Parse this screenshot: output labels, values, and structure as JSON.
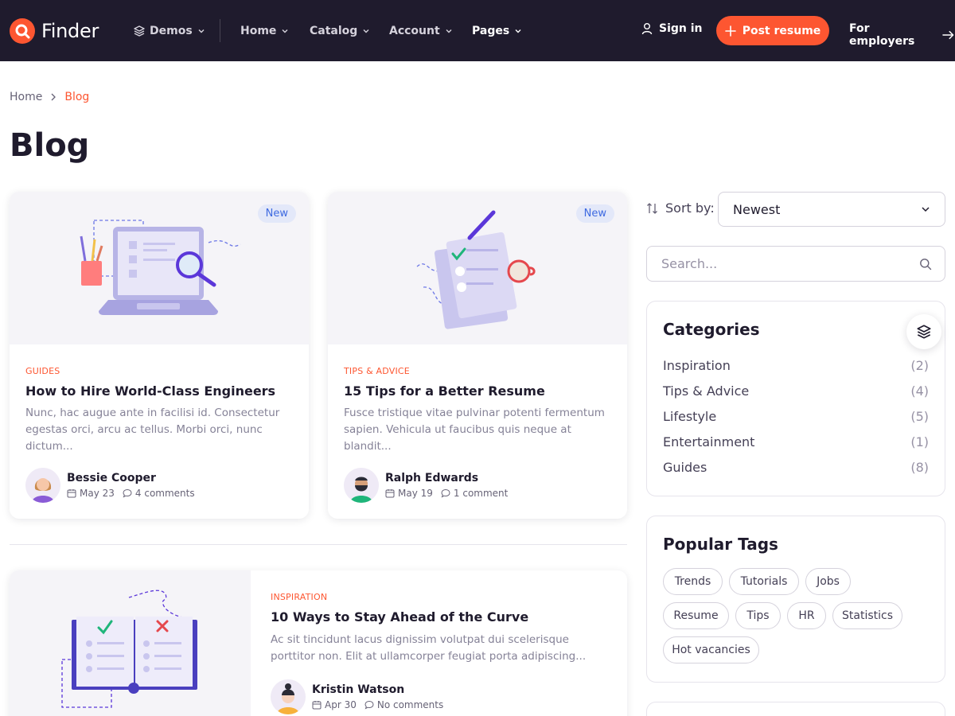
{
  "brand": {
    "name": "Finder",
    "accent": "#fd5631",
    "nav_bg": "#1f1b2d"
  },
  "nav": {
    "demos": "Demos",
    "home": "Home",
    "catalog": "Catalog",
    "account": "Account",
    "pages": "Pages",
    "sign_in": "Sign in",
    "post_resume": "Post resume",
    "for_employers": "For employers"
  },
  "breadcrumb": {
    "home": "Home",
    "current": "Blog"
  },
  "page_title": "Blog",
  "posts": [
    {
      "badge": "New",
      "category": "Guides",
      "title": "How to Hire World-Class Engineers",
      "excerpt": "Nunc, hac augue ante in facilisi id. Consectetur egestas orci, arcu ac tellus. Morbi orci, nunc dictum...",
      "author": "Bessie Cooper",
      "date": "May 23",
      "comments": "4 comments"
    },
    {
      "badge": "New",
      "category": "Tips & Advice",
      "title": "15 Tips for a Better Resume",
      "excerpt": "Fusce tristique vitae pulvinar potenti fermentum sapien. Vehicula ut faucibus quis neque at blandit...",
      "author": "Ralph Edwards",
      "date": "May 19",
      "comments": "1 comment"
    },
    {
      "category": "Inspiration",
      "title": "10 Ways to Stay Ahead of the Curve",
      "excerpt": "Ac sit tincidunt lacus dignissim volutpat dui scelerisque porttitor non. Elit at ullamcorper feugiat porta adipiscing...",
      "author": "Kristin Watson",
      "date": "Apr 30",
      "comments": "No comments"
    }
  ],
  "sidebar": {
    "sort_label": "Sort by:",
    "sort_value": "Newest",
    "search_placeholder": "Search...",
    "categories_title": "Categories",
    "categories": [
      {
        "name": "Inspiration",
        "count": "(2)"
      },
      {
        "name": "Tips & Advice",
        "count": "(4)"
      },
      {
        "name": "Lifestyle",
        "count": "(5)"
      },
      {
        "name": "Entertainment",
        "count": "(1)"
      },
      {
        "name": "Guides",
        "count": "(8)"
      }
    ],
    "tags_title": "Popular Tags",
    "tags": [
      "Trends",
      "Tutorials",
      "Jobs",
      "Resume",
      "Tips",
      "HR",
      "Statistics",
      "Hot vacancies"
    ]
  }
}
